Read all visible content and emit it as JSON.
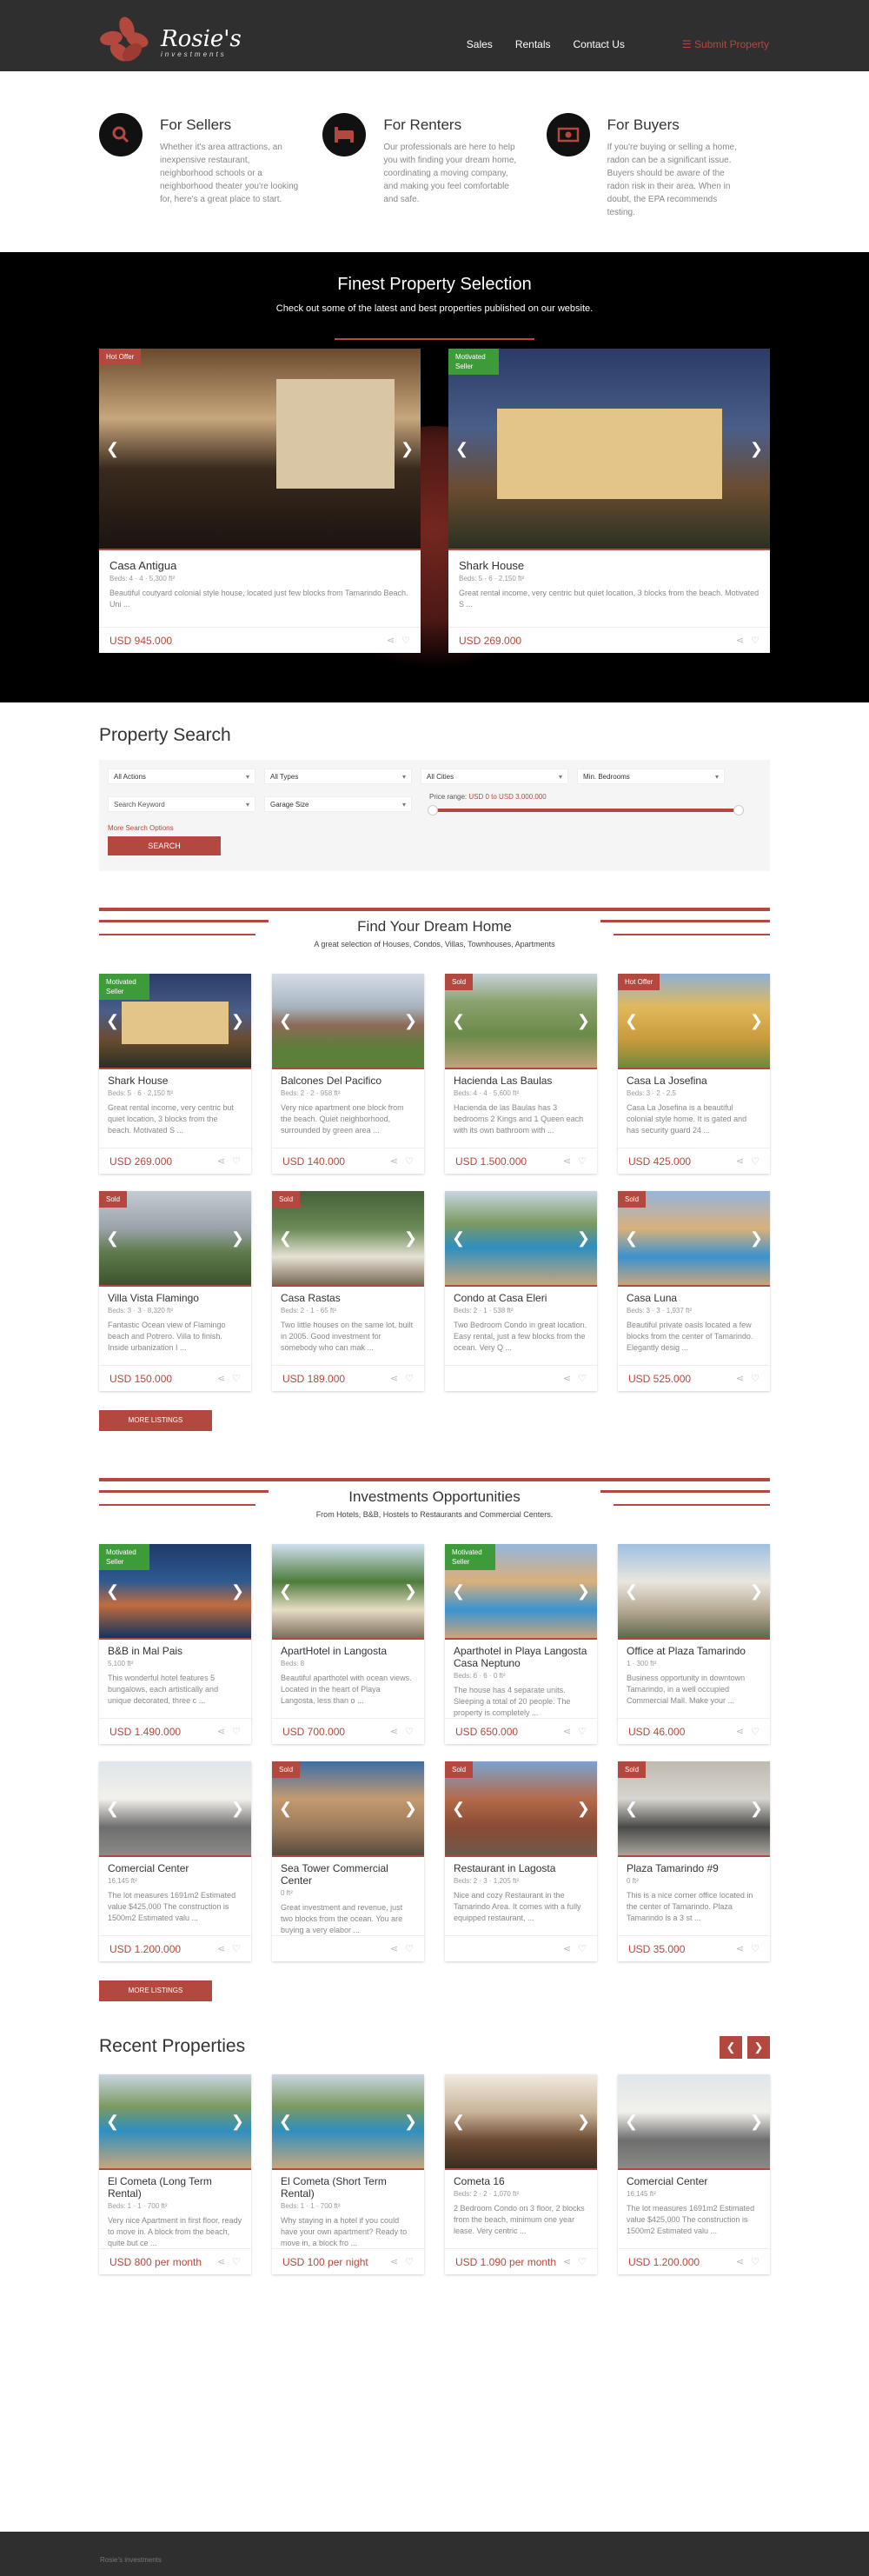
{
  "brand": {
    "name": "Rosie's",
    "tagline": "investments"
  },
  "nav": {
    "items": [
      "Sales",
      "Rentals",
      "Contact Us"
    ],
    "submit": "Submit Property"
  },
  "features": [
    {
      "icon": "magnifier-icon",
      "title": "For Sellers",
      "text": "Whether it's area attractions, an inexpensive restaurant, neighborhood schools or a neighborhood theater you're looking for, here's a great place to start."
    },
    {
      "icon": "bed-icon",
      "title": "For Renters",
      "text": "Our professionals are here to help you with finding your dream home, coordinating a moving company, and making you feel comfortable and safe."
    },
    {
      "icon": "money-icon",
      "title": "For Buyers",
      "text": "If you're buying or selling a home, radon can be a significant issue. Buyers should be aware of the radon risk in their area. When in doubt, the EPA recommends testing."
    }
  ],
  "finest": {
    "title": "Finest Property Selection",
    "subtitle": "Check out some of the latest and best properties published on our website.",
    "cards": [
      {
        "badge": "Hot Offer",
        "badge_color": "#b3483f",
        "title": "Casa Antigua",
        "meta": "Beds: 4  ·  4  ·  5,300 ft²",
        "desc": "Beautiful coutyard colonial style house, located just few blocks from Tamarindo Beach. Uni ...",
        "price": "USD 945.000",
        "scene": "kitchen"
      },
      {
        "badge": "Motivated Seller",
        "badge_color": "#3e9b3a",
        "title": "Shark House",
        "meta": "Beds: 5  ·  6  ·  2,150 ft²",
        "desc": "Great rental income, very centric but quiet location, 3 blocks from the beach. Motivated S ...",
        "price": "USD 269.000",
        "scene": "houseNight"
      }
    ]
  },
  "search": {
    "title": "Property Search",
    "actions": "All Actions",
    "types": "All Types",
    "cities": "All Cities",
    "bedrooms": "Min. Bedrooms",
    "keyword": "Search Keyword",
    "garage": "Garage Size",
    "range_label": "Price range:",
    "range_value": "USD 0 to USD 3.000.000",
    "more": "More Search Options",
    "button": "SEARCH"
  },
  "dream": {
    "title": "Find Your Dream Home",
    "subtitle": "A great selection of Houses, Condos, Villas, Townhouses, Apartments",
    "more": "MORE LISTINGS",
    "cards": [
      {
        "badge": "Motivated Seller",
        "badge_color": "#3e9b3a",
        "title": "Shark House",
        "meta": "Beds: 5  ·  6  ·  2,150 ft²",
        "desc": "Great rental income, very centric but quiet location, 3 blocks from the beach. Motivated S ...",
        "price": "USD 269.000",
        "scene": "houseNight"
      },
      {
        "badge": "",
        "badge_color": "",
        "title": "Balcones Del Pacifico",
        "meta": "Beds: 2  ·  2  ·  958 ft²",
        "desc": "Very nice apartment one block from the beach. Quiet neighborhood, surrounded by green area ...",
        "price": "USD 140.000",
        "scene": "garden"
      },
      {
        "badge": "Sold",
        "badge_color": "#b3483f",
        "title": "Hacienda Las Baulas",
        "meta": "Beds: 4  ·  4  ·  5,600 ft²",
        "desc": "Hacienda de las Baulas has 3 bedrooms 2 Kings and 1 Queen each with its own bathroom with ...",
        "price": "USD 1.500.000",
        "scene": "aerial"
      },
      {
        "badge": "Hot Offer",
        "badge_color": "#b3483f",
        "title": "Casa La Josefina",
        "meta": "Beds: 3  ·  2  ·  2.5",
        "desc": "Casa La Josefina is a beautiful colonial style home. It is gated and has security guard 24 ...",
        "price": "USD 425.000",
        "scene": "yellowHouse"
      },
      {
        "badge": "Sold",
        "badge_color": "#b3483f",
        "title": "Villa Vista Flamingo",
        "meta": "Beds: 3  ·  3  ·  8,320 ft²",
        "desc": "Fantastic Ocean view of Flamingo beach and Potrero. Villa to finish. Inside urbanization I ...",
        "price": "USD 150.000",
        "scene": "hills"
      },
      {
        "badge": "Sold",
        "badge_color": "#b3483f",
        "title": "Casa Rastas",
        "meta": "Beds: 2  ·  1  ·  65 ft²",
        "desc": "Two little houses on the same lot, built in 2005. Good investment for somebody who can mak ...",
        "price": "USD 189.000",
        "scene": "porch"
      },
      {
        "badge": "",
        "badge_color": "",
        "title": "Condo at Casa Eleri",
        "meta": "Beds: 2  ·  1  ·  538 ft²",
        "desc": "Two Bedroom Condo in great location. Easy rental, just a few blocks from the ocean. Very Q ...",
        "price": "",
        "scene": "pool"
      },
      {
        "badge": "Sold",
        "badge_color": "#b3483f",
        "title": "Casa Luna",
        "meta": "Beds: 3  ·  3  ·  1,937 ft²",
        "desc": "Beautiful private oasis located a few blocks from the center of Tamarindo. Elegantly desig ...",
        "price": "USD 525.000",
        "scene": "poolHouse"
      }
    ]
  },
  "invest": {
    "title": "Investments Opportunities",
    "subtitle": "From Hotels, B&B, Hostels to Restaurants and Commercial Centers.",
    "more": "MORE LISTINGS",
    "cards": [
      {
        "badge": "Motivated Seller",
        "badge_color": "#3e9b3a",
        "title": "B&B in Mal Pais",
        "meta": "5,100 ft²",
        "desc": "This wonderful hotel features 5 bungalows, each artistically and unique decorated, three c ...",
        "price": "USD 1.490.000",
        "scene": "resortNight"
      },
      {
        "badge": "",
        "badge_color": "",
        "title": "ApartHotel in Langosta",
        "meta": "Beds: 8",
        "desc": "Beautiful aparthotel with ocean views. Located in the heart of Playa Langosta, less than o ...",
        "price": "USD 700.000",
        "scene": "palms"
      },
      {
        "badge": "Motivated Seller",
        "badge_color": "#3e9b3a",
        "title": "Aparthotel in Playa Langosta Casa Neptuno",
        "meta": "Beds: 6  ·  6  ·  0 ft²",
        "desc": "The house has 4 separate units. Sleeping a total of 20 people. The property is completely ...",
        "price": "USD 650.000",
        "scene": "poolHouse"
      },
      {
        "badge": "",
        "badge_color": "",
        "title": "Office at Plaza Tamarindo",
        "meta": "1  ·  300 ft²",
        "desc": "Business opportunity in downtown Tamarindo, in a well occupied Commercial Mall. Make your ...",
        "price": "USD 46.000",
        "scene": "building"
      },
      {
        "badge": "",
        "badge_color": "",
        "title": "Comercial Center",
        "meta": "16,145 ft²",
        "desc": "The lot measures 1691m2 Estimated value $425,000 The construction is 1500m2 Estimated valu ...",
        "price": "USD 1.200.000",
        "scene": "parking"
      },
      {
        "badge": "Sold",
        "badge_color": "#b3483f",
        "title": "Sea Tower Commercial Center",
        "meta": "0 ft²",
        "desc": "Great investment and revenue, just two blocks from the ocean. You are buying a very elabor ...",
        "price": "",
        "scene": "tower"
      },
      {
        "badge": "Sold",
        "badge_color": "#b3483f",
        "title": "Restaurant in Lagosta",
        "meta": "Beds: 2  ·  3  ·  1,205 ft²",
        "desc": "Nice and cozy Restaurant in the Tamarindo Area. It comes with a fully equipped restaurant, ...",
        "price": "",
        "scene": "arches"
      },
      {
        "badge": "Sold",
        "badge_color": "#b3483f",
        "title": "Plaza Tamarindo #9",
        "meta": "0 ft²",
        "desc": "This is a nice corner office located in the center of Tamarindo. Plaza Tamarindo is a 3 st ...",
        "price": "USD 35.000",
        "scene": "office"
      }
    ]
  },
  "recent": {
    "title": "Recent Properties",
    "cards": [
      {
        "badge": "",
        "badge_color": "",
        "title": "El Cometa (Long Term Rental)",
        "meta": "Beds: 1  ·  1  ·  700 ft²",
        "desc": "Very nice Apartment in first floor, ready to move in. A block from the beach, quite but ce ...",
        "price": "USD 800 per month",
        "scene": "pool"
      },
      {
        "badge": "",
        "badge_color": "",
        "title": "El Cometa (Short Term Rental)",
        "meta": "Beds: 1  ·  1  ·  700 ft²",
        "desc": "Why staying in a hotel if you could have your own apartment? Ready to move in, a block fro ...",
        "price": "USD 100 per night",
        "scene": "pool"
      },
      {
        "badge": "",
        "badge_color": "",
        "title": "Cometa 16",
        "meta": "Beds: 2  ·  2  ·  1,070 ft²",
        "desc": "2 Bedroom Condo on 3 floor, 2 blocks from the beach, minimum one year lease. Very centric ...",
        "price": "USD 1.090 per month",
        "scene": "interior"
      },
      {
        "badge": "",
        "badge_color": "",
        "title": "Comercial Center",
        "meta": "16,145 ft²",
        "desc": "The lot measures 1691m2 Estimated value $425,000 The construction is 1500m2 Estimated valu ...",
        "price": "USD 1.200.000",
        "scene": "parking"
      }
    ]
  },
  "footer": {
    "text": "Rosie's investments"
  }
}
